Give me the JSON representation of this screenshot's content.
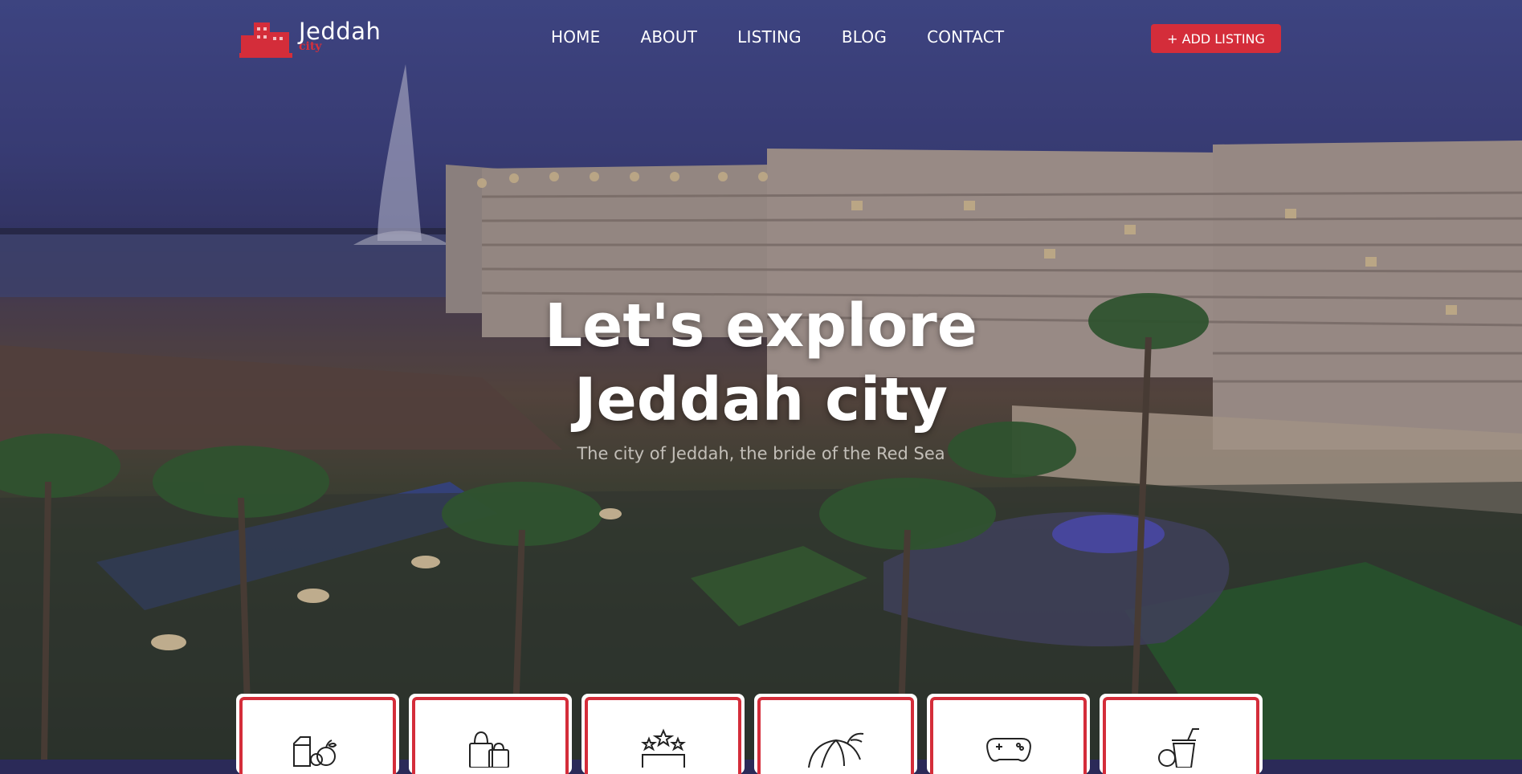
{
  "header": {
    "logo": {
      "name": "Jeddah",
      "sub": "city"
    },
    "nav": [
      "HOME",
      "ABOUT",
      "LISTING",
      "BLOG",
      "CONTACT"
    ],
    "add_listing": "+ ADD LISTING"
  },
  "hero": {
    "title_line1": "Let's explore",
    "title_line2": "Jeddah city",
    "subtitle": "The city of Jeddah, the bride of the Red Sea"
  },
  "categories": [
    {
      "icon": "food-icon"
    },
    {
      "icon": "shopping-icon"
    },
    {
      "icon": "hotel-icon"
    },
    {
      "icon": "beach-icon"
    },
    {
      "icon": "gaming-icon"
    },
    {
      "icon": "drinks-icon"
    }
  ],
  "colors": {
    "accent": "#d42d3a",
    "text": "#ffffff"
  }
}
